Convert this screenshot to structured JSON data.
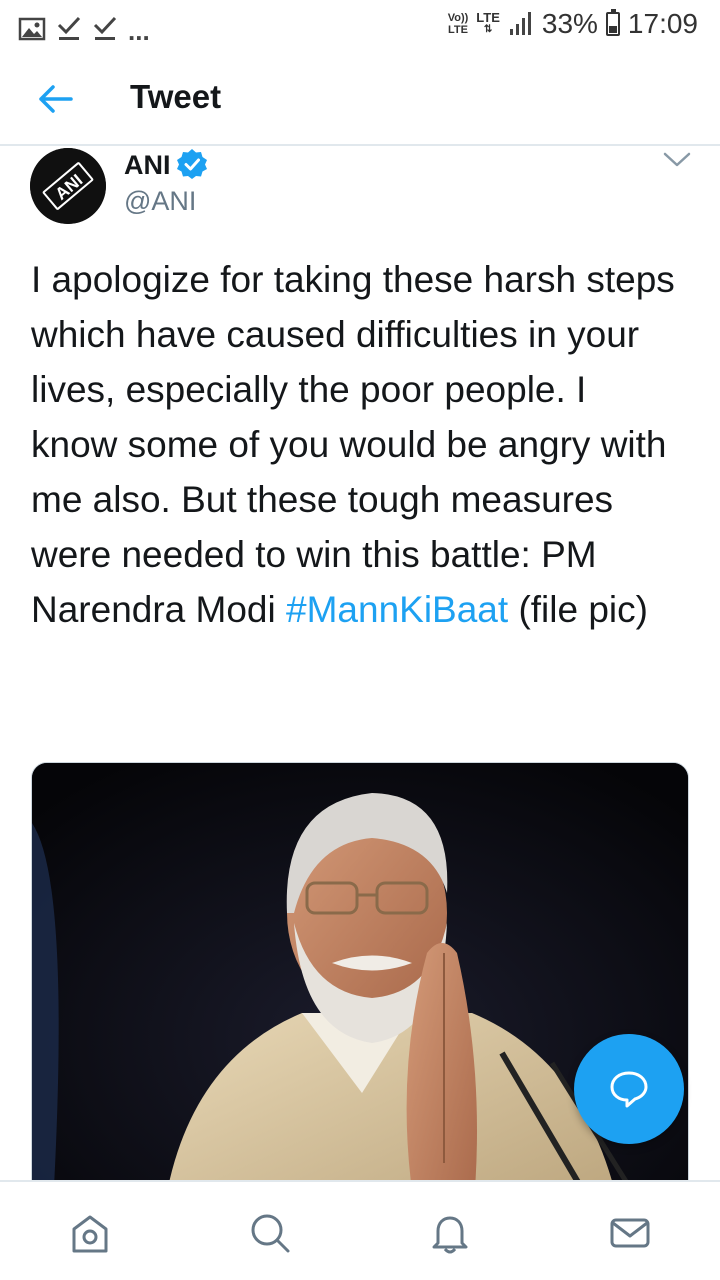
{
  "status_bar": {
    "more_indicator": "...",
    "volte_top": "Vo))",
    "volte_bottom": "LTE",
    "network": "LTE",
    "battery_percent": "33%",
    "battery_level": 0.33,
    "time": "17:09",
    "icons": [
      "gallery-icon",
      "check-icon",
      "check-icon",
      "signal-icon",
      "battery-icon"
    ]
  },
  "header": {
    "title": "Tweet",
    "back_icon": "arrow-left-icon"
  },
  "tweet": {
    "author_name": "ANI",
    "author_handle": "@ANI",
    "avatar_text": "ANI",
    "verified_icon": "verified-badge-icon",
    "menu_icon": "chevron-down-icon",
    "text_before_hashtag": "I apologize for taking these harsh steps which have caused difficulties in your lives, especially the poor people. I know some of you would be angry with me also. But these tough measures were needed to win this battle: PM Narendra Modi ",
    "hashtag": "#MannKiBaat",
    "text_after_hashtag": " (file pic)",
    "media": "photo of a man with white hair and beard folding his hands in greeting"
  },
  "fab": {
    "icon": "reply-bubble-icon"
  },
  "bottom_nav": {
    "items": [
      "home-icon",
      "search-icon",
      "notifications-icon",
      "messages-icon"
    ]
  },
  "colors": {
    "accent": "#1da1f2",
    "text": "#14171a",
    "secondary_text": "#657786",
    "divider": "#e1e8ed"
  }
}
